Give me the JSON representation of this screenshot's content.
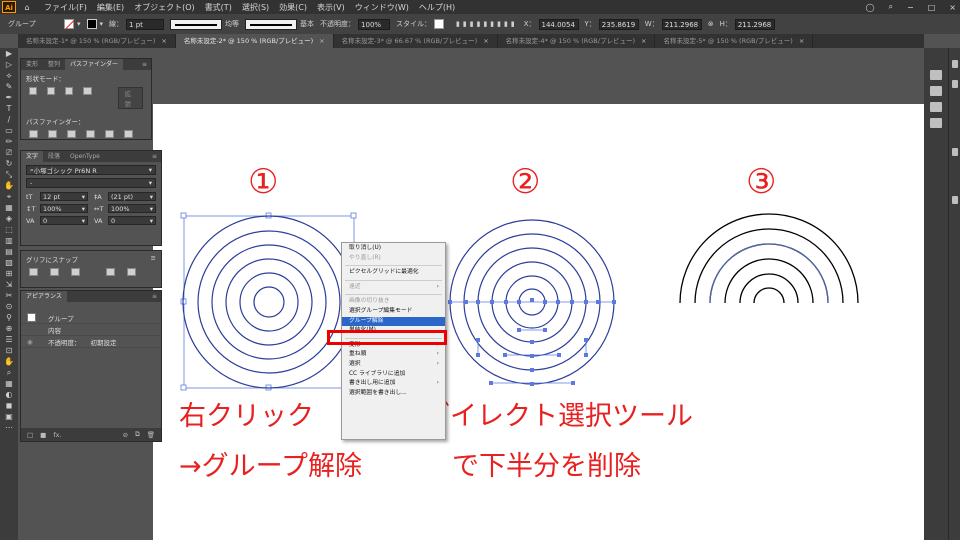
{
  "app": {
    "logo": "Ai",
    "menu": [
      "ファイル(F)",
      "編集(E)",
      "オブジェクト(O)",
      "書式(T)",
      "選択(S)",
      "効果(C)",
      "表示(V)",
      "ウィンドウ(W)",
      "ヘルプ(H)"
    ],
    "menu_right": [
      "検索",
      "−",
      "□",
      "×"
    ]
  },
  "control": {
    "selection": "グループ",
    "stroke_label": "線：",
    "stroke_weight": "1 pt",
    "uniform": "均等",
    "basic": "基本",
    "opacity_label": "不透明度：",
    "opacity": "100%",
    "style_label": "スタイル：",
    "x_label": "X：",
    "x": "144.0054",
    "y_label": "Y：",
    "y": "235.8619",
    "w_label": "W：",
    "w": "211.2968",
    "h_label": "H：",
    "h": "211.2968"
  },
  "tabs": [
    {
      "label": "名称未設定-1* @ 150 % (RGB/プレビュー)",
      "active": false
    },
    {
      "label": "名称未設定-2* @ 150 % (RGB/プレビュー)",
      "active": true
    },
    {
      "label": "名称未設定-3* @ 66.67 % (RGB/プレビュー)",
      "active": false
    },
    {
      "label": "名称未設定-4* @ 150 % (RGB/プレビュー)",
      "active": false
    },
    {
      "label": "名称未設定-5* @ 150 % (RGB/プレビュー)",
      "active": false
    }
  ],
  "pathfinder": {
    "tabs": [
      "変形",
      "整列",
      "パスファインダー"
    ],
    "shape_mode_label": "形状モード：",
    "expand": "拡張",
    "pathfinder_label": "パスファインダー："
  },
  "character": {
    "tabs": [
      "文字",
      "段落",
      "OpenType"
    ],
    "font": "小塚ゴシック Pr6N R",
    "style": "-",
    "size": "12 pt",
    "leading": "(21 pt)",
    "vscale": "100%",
    "hscale": "100%",
    "kerning": "0",
    "tracking": "0"
  },
  "glyph_snap": {
    "title": "グリフにスナップ"
  },
  "appearance": {
    "title": "アピアランス",
    "rows": [
      {
        "label": "グループ",
        "value": ""
      },
      {
        "label": "内容",
        "value": ""
      },
      {
        "label": "不透明度：",
        "value": "初期設定"
      }
    ]
  },
  "context_menu": {
    "items": [
      {
        "label": "取り消し(U)",
        "disabled": false,
        "sub": false,
        "sep_after": false
      },
      {
        "label": "やり直し(R)",
        "disabled": true,
        "sub": false,
        "sep_after": true
      },
      {
        "label": "ピクセルグリッドに最適化",
        "disabled": false,
        "sub": false,
        "sep_after": true
      },
      {
        "label": "遠近",
        "disabled": true,
        "sub": true,
        "sep_after": true
      },
      {
        "label": "画像の切り抜き",
        "disabled": true,
        "sub": false,
        "sep_after": false
      },
      {
        "label": "選択グループ編集モード",
        "disabled": false,
        "sub": false,
        "sep_after": false
      },
      {
        "label": "グループ解除",
        "disabled": false,
        "sub": false,
        "sep_after": false,
        "highlight": true
      },
      {
        "label": "単純化(M)...",
        "disabled": false,
        "sub": false,
        "sep_after": true
      },
      {
        "label": "変形",
        "disabled": false,
        "sub": true,
        "sep_after": false
      },
      {
        "label": "重ね順",
        "disabled": false,
        "sub": true,
        "sep_after": false
      },
      {
        "label": "選択",
        "disabled": false,
        "sub": true,
        "sep_after": false
      },
      {
        "label": "CC ライブラリに追加",
        "disabled": false,
        "sub": false,
        "sep_after": false
      },
      {
        "label": "書き出し用に追加",
        "disabled": false,
        "sub": true,
        "sep_after": false
      },
      {
        "label": "選択範囲を書き出し...",
        "disabled": false,
        "sub": false,
        "sep_after": false
      }
    ]
  },
  "artboard": {
    "labels": [
      "①",
      "②",
      "③"
    ],
    "caption1": [
      "右クリック",
      "→グループ解除"
    ],
    "caption2": [
      "ダイレクト選択ツール",
      "で下半分を削除"
    ]
  },
  "colors": {
    "accent_red": "#e82020",
    "selection_blue": "#3a5bd0",
    "menu_highlight": "#2b67c9"
  }
}
